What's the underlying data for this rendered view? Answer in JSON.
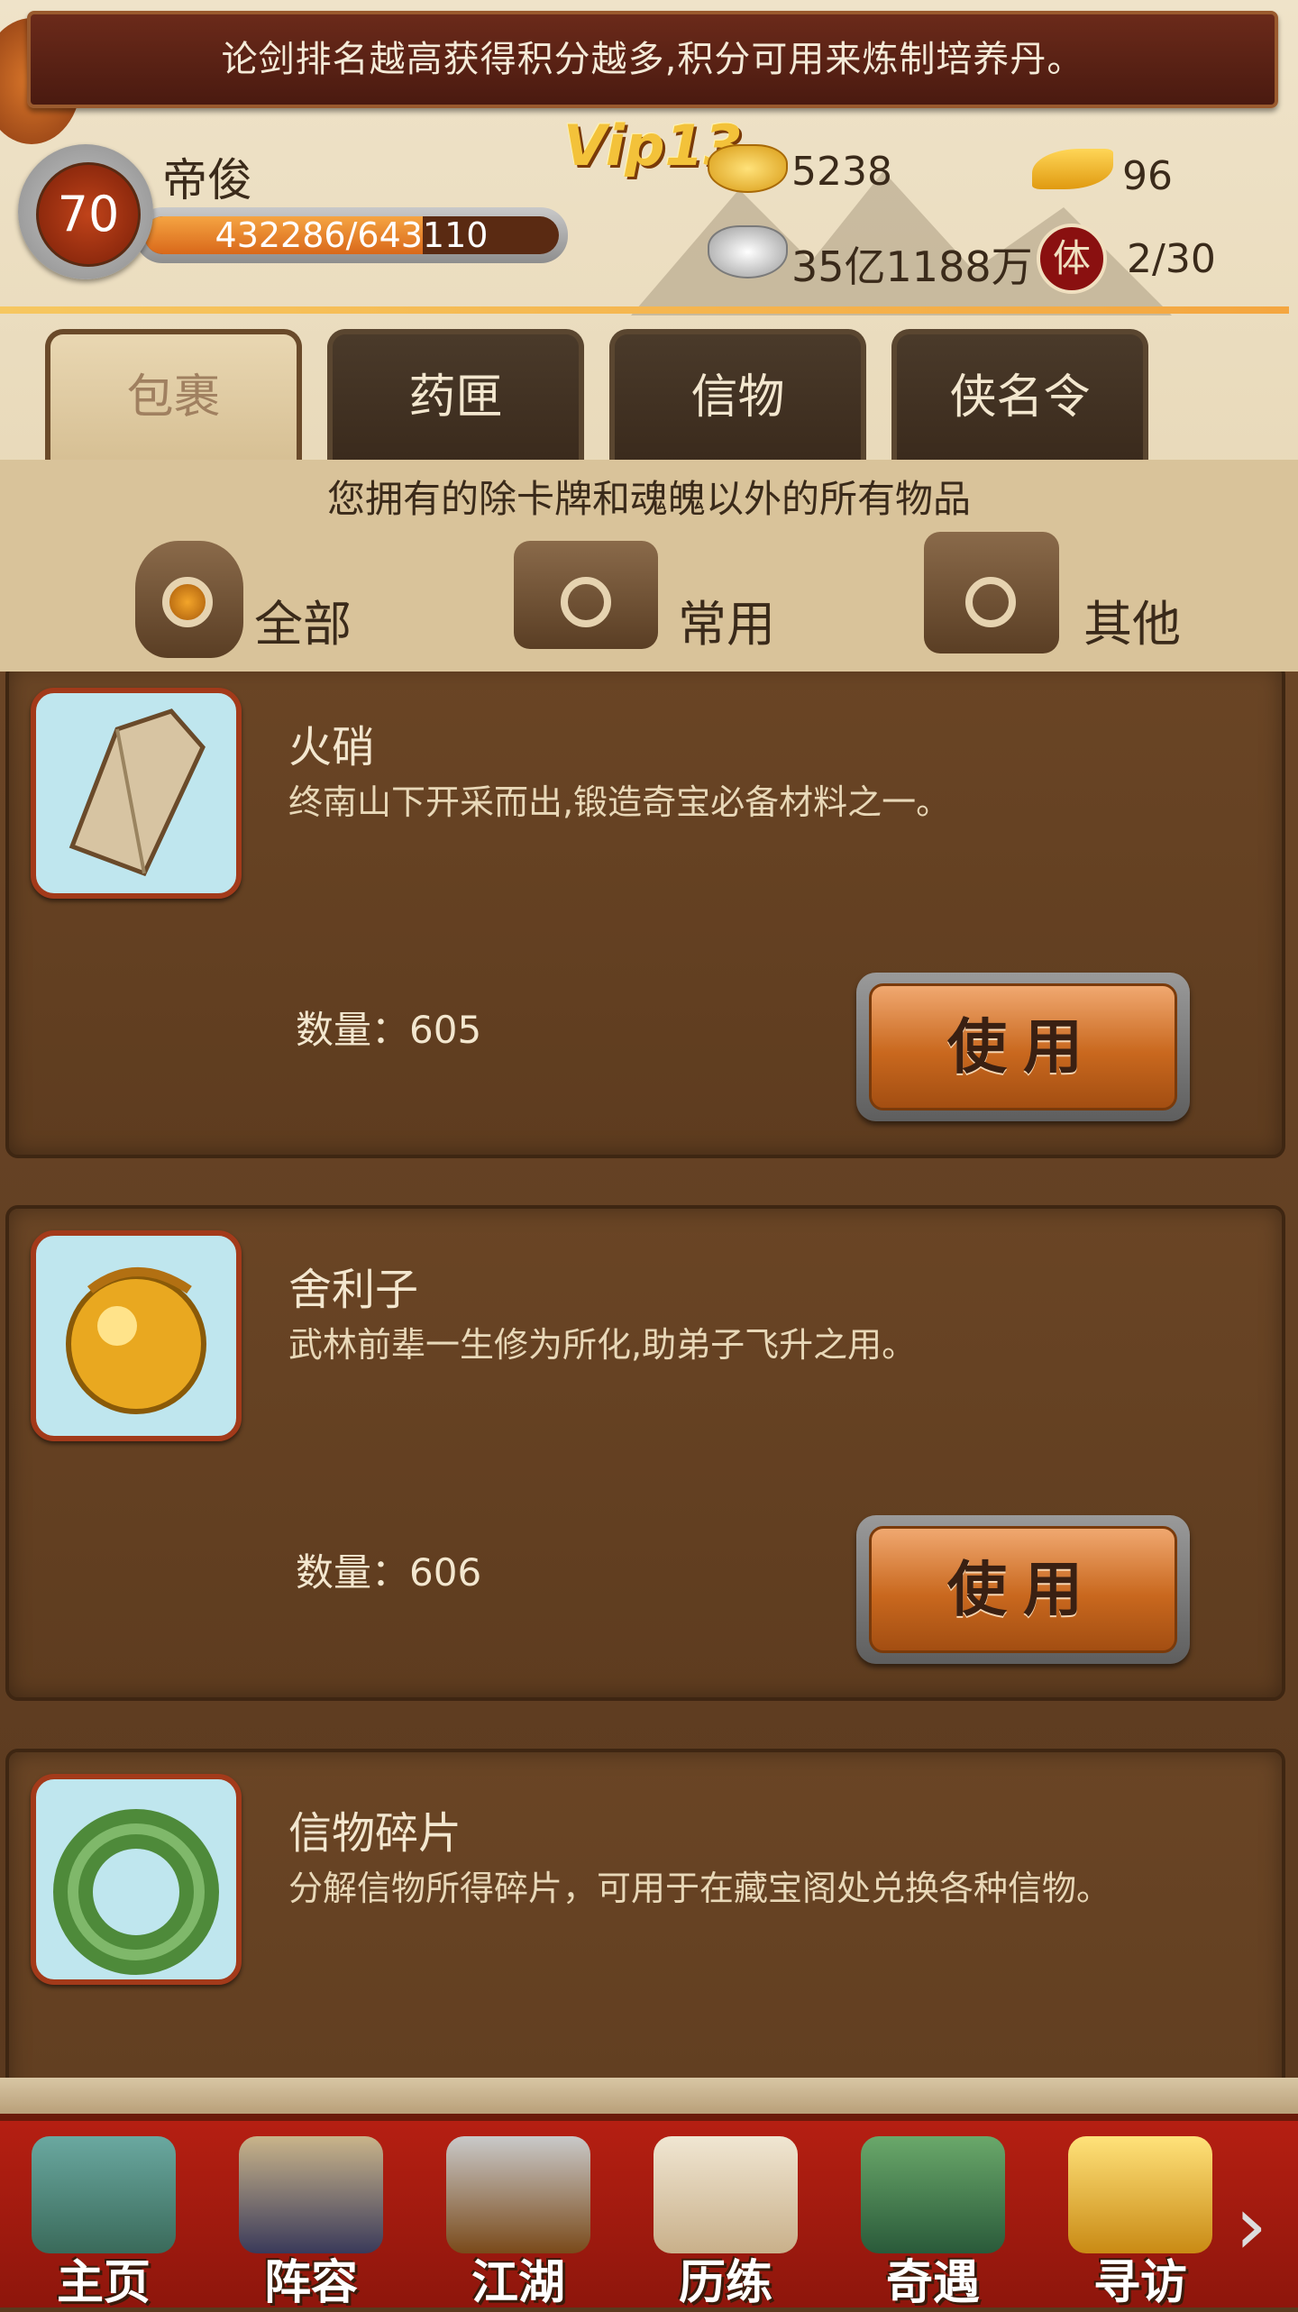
{
  "marquee": "论剑排名越高获得积分越多,积分可用来炼制培养丹。",
  "player": {
    "level": "70",
    "name": "帝俊",
    "exp_text": "432286/643110",
    "exp_fraction": 0.672,
    "vip": "Vip13",
    "gold": "5238",
    "leaf_gold": "96",
    "silver": "35亿1188万",
    "stamina_icon": "体",
    "stamina": "2/30"
  },
  "tabs": [
    {
      "label": "包裹",
      "active": true
    },
    {
      "label": "药匣"
    },
    {
      "label": "信物"
    },
    {
      "label": "侠名令"
    }
  ],
  "category": {
    "description": "您拥有的除卡牌和魂魄以外的所有物品",
    "items": [
      {
        "label": "全部",
        "icon": "bag-icon",
        "active": true
      },
      {
        "label": "常用",
        "icon": "box-icon"
      },
      {
        "label": "其他",
        "icon": "open-box-icon"
      }
    ]
  },
  "items": [
    {
      "name": "火硝",
      "desc": "终南山下开采而出,锻造奇宝必备材料之一。",
      "qty": "数量：605",
      "button": "使用",
      "icon": "stone-icon"
    },
    {
      "name": "舍利子",
      "desc": "武林前辈一生修为所化,助弟子飞升之用。",
      "qty": "数量：606",
      "button": "使用",
      "icon": "golden-orb-icon"
    },
    {
      "name": "信物碎片",
      "desc": "分解信物所得碎片，可用于在藏宝阁处兑换各种信物。",
      "qty": "",
      "button": "",
      "icon": "jade-ring-icon"
    }
  ],
  "nav": [
    {
      "label": "主页",
      "icon": "temple-icon"
    },
    {
      "label": "阵容",
      "icon": "warrior-icon"
    },
    {
      "label": "江湖",
      "icon": "sword-icon"
    },
    {
      "label": "历练",
      "icon": "scroll-icon"
    },
    {
      "label": "奇遇",
      "icon": "mountain-icon"
    },
    {
      "label": "寻访",
      "icon": "treasure-icon"
    }
  ],
  "nav_more": "›",
  "colors": {
    "accent": "#c9681e",
    "nav_bg": "#b51f12",
    "list_bg": "#5e3c1f"
  }
}
